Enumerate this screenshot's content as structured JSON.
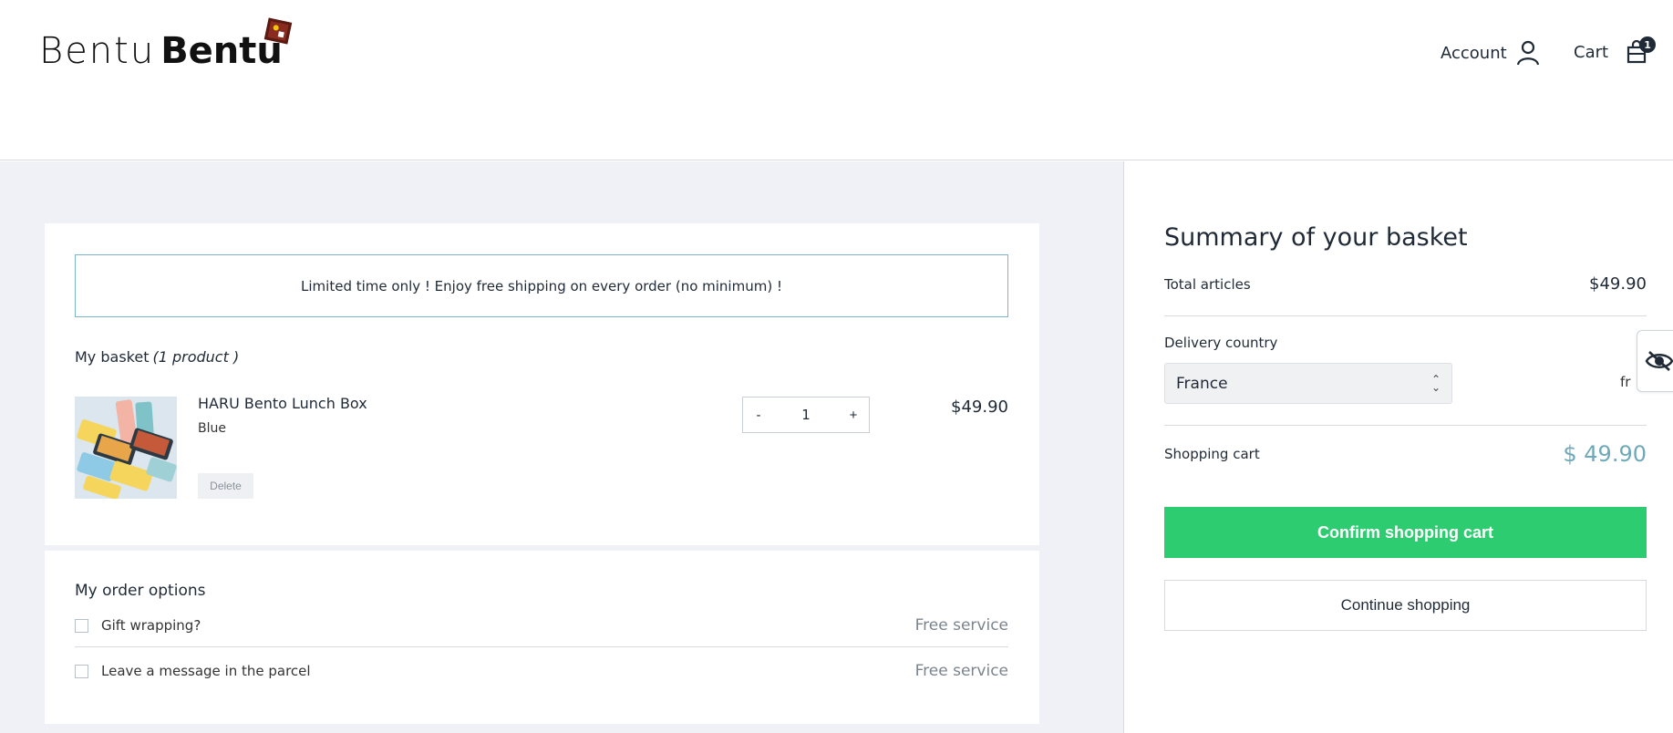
{
  "header": {
    "logo_light": "Bentu",
    "logo_bold": "Bentu",
    "account_label": "Account",
    "cart_label": "Cart",
    "cart_badge": "1"
  },
  "basket": {
    "promo_text": "Limited time only ! Enjoy free shipping on every order  (no minimum) !",
    "title": "My basket",
    "count_text": "(1 product )",
    "product": {
      "name": "HARU Bento Lunch Box",
      "variant": "Blue",
      "delete_label": "Delete",
      "qty_minus": "-",
      "qty_value": "1",
      "qty_plus": "+",
      "price": "$49.90"
    }
  },
  "options": {
    "title": "My order options",
    "items": [
      {
        "label": "Gift wrapping?",
        "value": "Free service"
      },
      {
        "label": "Leave a message in the parcel",
        "value": "Free service"
      }
    ]
  },
  "summary": {
    "title": "Summary of your basket",
    "total_articles_label": "Total articles",
    "total_articles_value": "$49.90",
    "delivery_label": "Delivery country",
    "delivery_country": "France",
    "delivery_value_partial": "fr",
    "shopping_cart_label": "Shopping cart",
    "shopping_cart_value": "$ 49.90",
    "confirm_label": "Confirm shopping cart",
    "continue_label": "Continue shopping"
  },
  "colors": {
    "confirm_bg": "#2ecc71",
    "cart_total": "#6fa9b7",
    "promo_border": "#7cb3c9",
    "page_bg": "#eff1f6"
  }
}
